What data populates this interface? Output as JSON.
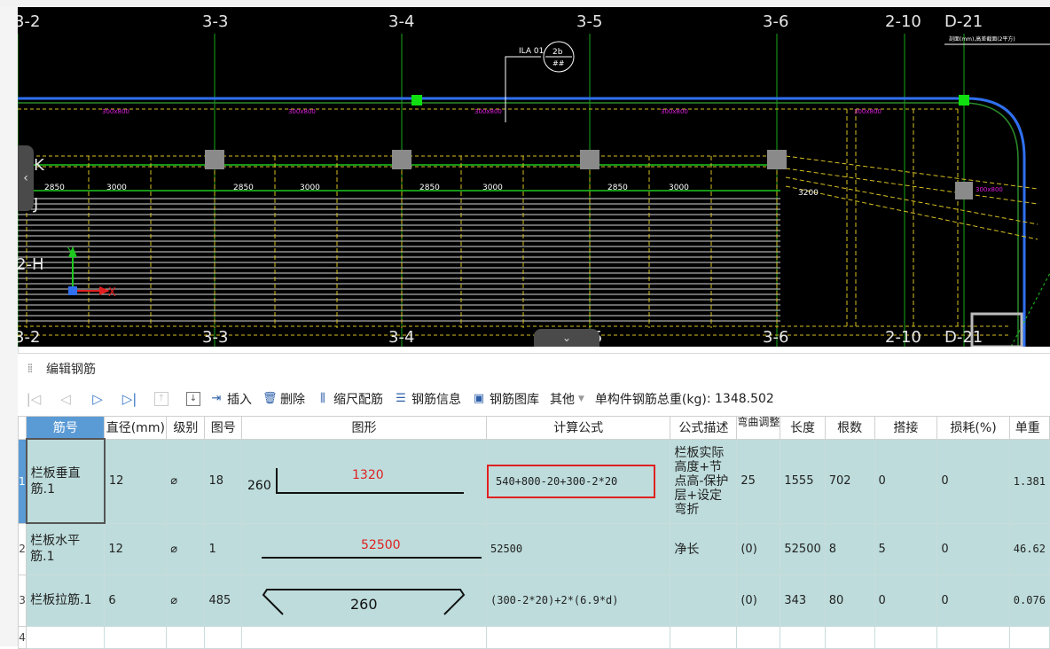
{
  "cad": {
    "axis_labels_top": [
      "3-2",
      "3-3",
      "3-4",
      "3-5",
      "3-6",
      "2-10",
      "D-21"
    ],
    "axis_labels_bottom": [
      "3-2",
      "3-3",
      "3-4",
      "3-5",
      "3-6",
      "2-10",
      "D-21"
    ],
    "row_labels": [
      "K",
      "J",
      "2-H"
    ],
    "dims": [
      "2850",
      "3000",
      "2850",
      "3000",
      "2850",
      "3000",
      "2850",
      "3000",
      "3200"
    ],
    "beam_tags": [
      "300x800",
      "300x800",
      "300x800",
      "300x800",
      "300x800",
      "300x800"
    ],
    "leader_text": "ILA 01",
    "bubble_text": [
      "2b",
      "##"
    ],
    "corner_note": "剖面(mm),高差截面(2平方)",
    "axis_x": "X",
    "axis_y": "Y",
    "colors": {
      "bg": "#000000",
      "grid": "#18a818",
      "beam": "#d8c020",
      "rebar": "#e8e8e8",
      "slab_green": "#1ec81e",
      "edge_blue": "#3070f0",
      "text_magenta": "#e020e0",
      "column": "#8a8a8a"
    }
  },
  "panel": {
    "title": "编辑钢筋",
    "toolbar": {
      "insert": "插入",
      "delete": "删除",
      "scale_rebar": "缩尺配筋",
      "rebar_info": "钢筋信息",
      "rebar_library": "钢筋图库",
      "other": "其他",
      "total_weight_label": "单构件钢筋总重(kg)",
      "total_weight_value": "1348.502"
    },
    "columns": [
      "筋号",
      "直径(mm)",
      "级别",
      "图号",
      "图形",
      "计算公式",
      "公式描述",
      "弯曲调整",
      "长度",
      "根数",
      "搭接",
      "损耗(%)",
      "单重"
    ],
    "rows": [
      {
        "num": "1",
        "name": "栏板垂直筋.1",
        "diameter": "12",
        "grade": "⌀",
        "fig": "18",
        "shape_left": "260",
        "shape_top": "1320",
        "formula": "540+800-20+300-2*20",
        "desc": "栏板实际高度+节点高-保护层+设定弯折",
        "bend": "25",
        "length": "1555",
        "count": "702",
        "lap": "0",
        "loss": "0",
        "unit_weight": "1.381"
      },
      {
        "num": "2",
        "name": "栏板水平筋.1",
        "diameter": "12",
        "grade": "⌀",
        "fig": "1",
        "shape_top": "52500",
        "formula": "52500",
        "desc": "净长",
        "bend": "(0)",
        "length": "52500",
        "count": "8",
        "lap": "5",
        "loss": "0",
        "unit_weight": "46.62"
      },
      {
        "num": "3",
        "name": "栏板拉筋.1",
        "diameter": "6",
        "grade": "⌀",
        "fig": "485",
        "shape_mid": "260",
        "formula": "(300-2*20)+2*(6.9*d)",
        "desc": "",
        "bend": "(0)",
        "length": "343",
        "count": "80",
        "lap": "0",
        "loss": "0",
        "unit_weight": "0.076"
      }
    ],
    "empty_row_num": "4"
  }
}
